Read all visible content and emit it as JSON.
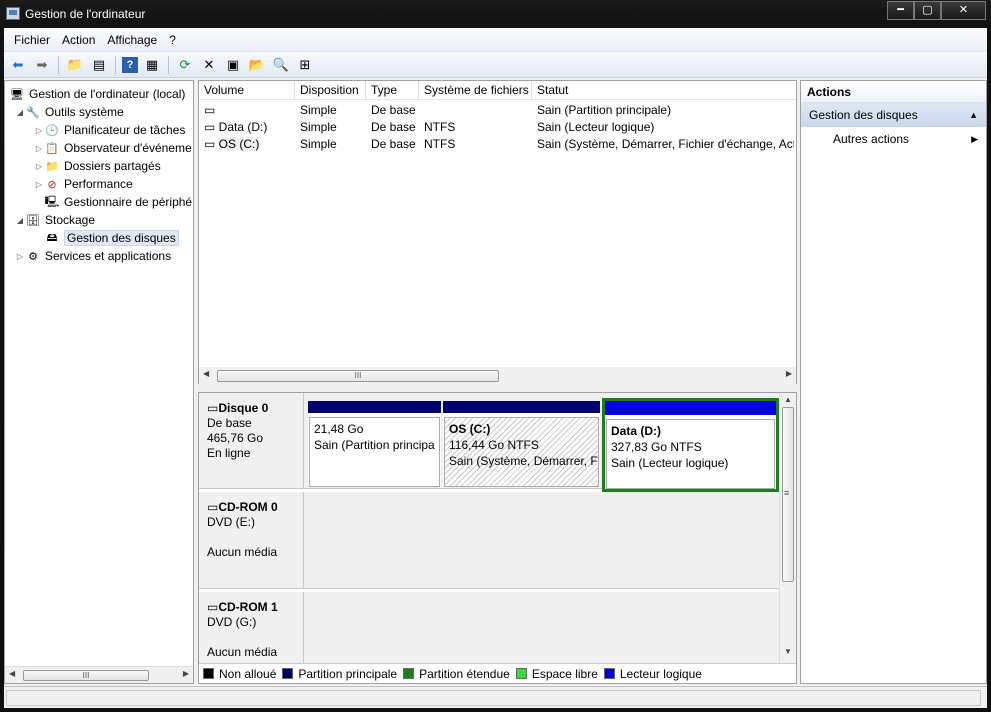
{
  "window": {
    "title": "Gestion de l'ordinateur",
    "controls": {
      "minimize": "━",
      "maximize": "▢",
      "close": "✕"
    }
  },
  "menu": [
    "Fichier",
    "Action",
    "Affichage",
    "?"
  ],
  "toolbar": {
    "icons": [
      "back-arrow-icon",
      "forward-arrow-icon",
      "folder-up-icon",
      "show-hide-tree-icon",
      "help-icon",
      "console-view-icon",
      "refresh-icon",
      "delete-icon",
      "properties-icon",
      "open-icon",
      "search-icon",
      "export-icon"
    ],
    "glyphs": {
      "back": "⬅",
      "forward": "➡",
      "folder_up": "📁",
      "tree": "▤",
      "help": "?",
      "view": "▦",
      "refresh": "⟳",
      "delete": "✕",
      "properties": "▣",
      "open": "📂",
      "search": "🔍",
      "export": "⊞"
    }
  },
  "tree": {
    "root": "Gestion de l'ordinateur (local)",
    "outils": "Outils système",
    "planificateur": "Planificateur de tâches",
    "observateur": "Observateur d'événeme",
    "dossiers": "Dossiers partagés",
    "performance": "Performance",
    "gestionnaire": "Gestionnaire de périphé",
    "stockage": "Stockage",
    "gestion_disques": "Gestion des disques",
    "services": "Services et applications"
  },
  "volumes": {
    "headers": [
      "Volume",
      "Disposition",
      "Type",
      "Système de fichiers",
      "Statut"
    ],
    "rows": [
      {
        "volume": "",
        "disposition": "Simple",
        "type": "De base",
        "fs": "",
        "statut": "Sain (Partition principale)"
      },
      {
        "volume": "Data (D:)",
        "disposition": "Simple",
        "type": "De base",
        "fs": "NTFS",
        "statut": "Sain (Lecteur logique)"
      },
      {
        "volume": "OS (C:)",
        "disposition": "Simple",
        "type": "De base",
        "fs": "NTFS",
        "statut": "Sain (Système, Démarrer, Fichier d'échange, Acti"
      }
    ]
  },
  "disks": [
    {
      "name": "Disque 0",
      "type": "De base",
      "size": "465,76 Go",
      "state": "En ligne"
    },
    {
      "name": "CD-ROM 0",
      "type": "DVD (E:)",
      "size": "",
      "state": "Aucun média"
    },
    {
      "name": "CD-ROM 1",
      "type": "DVD (G:)",
      "size": "",
      "state": "Aucun média"
    }
  ],
  "partitions": [
    {
      "name": "",
      "size": "21,48 Go",
      "status": "Sain (Partition principa"
    },
    {
      "name": "OS  (C:)",
      "size": "116,44 Go NTFS",
      "status": "Sain (Système, Démarrer, Fi"
    },
    {
      "name": "Data  (D:)",
      "size": "327,83 Go NTFS",
      "status": "Sain (Lecteur logique)"
    }
  ],
  "legend": [
    {
      "label": "Non alloué",
      "color": "#000000"
    },
    {
      "label": "Partition principale",
      "color": "#00006b"
    },
    {
      "label": "Partition étendue",
      "color": "#1e7d1e"
    },
    {
      "label": "Espace libre",
      "color": "#33dd33"
    },
    {
      "label": "Lecteur logique",
      "color": "#0000e0"
    }
  ],
  "actions": {
    "header": "Actions",
    "group": "Gestion des disques",
    "item": "Autres actions"
  },
  "scroll": {
    "grip": "III",
    "vgrip": "≡"
  },
  "colors": {
    "accent_selected": "#1e7d1e",
    "primary_partition": "#00006b",
    "logical_drive": "#0000e0"
  }
}
